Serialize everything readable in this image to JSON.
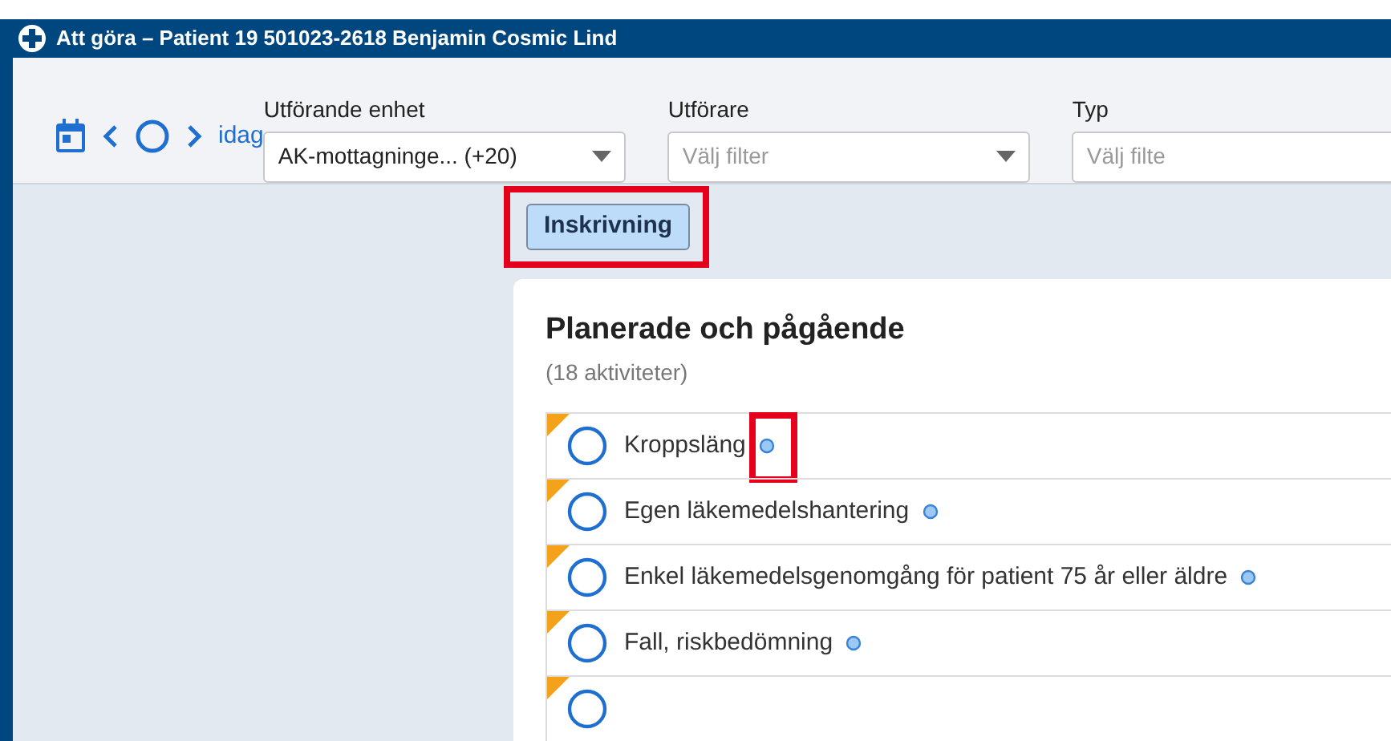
{
  "window": {
    "title": "Att göra – Patient 19 501023-2618 Benjamin Cosmic Lind"
  },
  "toolbar": {
    "today_link": "idag",
    "filters": [
      {
        "label": "Utförande enhet",
        "value": "AK-mottagninge... (+20)",
        "caret": true
      },
      {
        "label": "Utförare",
        "placeholder": "Välj filter",
        "caret": true
      },
      {
        "label": "Typ",
        "placeholder": "Välj filte"
      }
    ]
  },
  "tag": {
    "label": "Inskrivning",
    "highlighted": true
  },
  "card": {
    "title": "Planerade och pågående",
    "count": "(18 aktiviteter)",
    "activities": [
      {
        "name": "Kroppsläng",
        "highlighted": true
      },
      {
        "name": "Egen läkemedelshantering",
        "highlighted": false
      },
      {
        "name": "Enkel läkemedelsgenomgång för patient 75 år eller äldre",
        "highlighted": false
      },
      {
        "name": "Fall, riskbedömning",
        "highlighted": false
      }
    ]
  }
}
